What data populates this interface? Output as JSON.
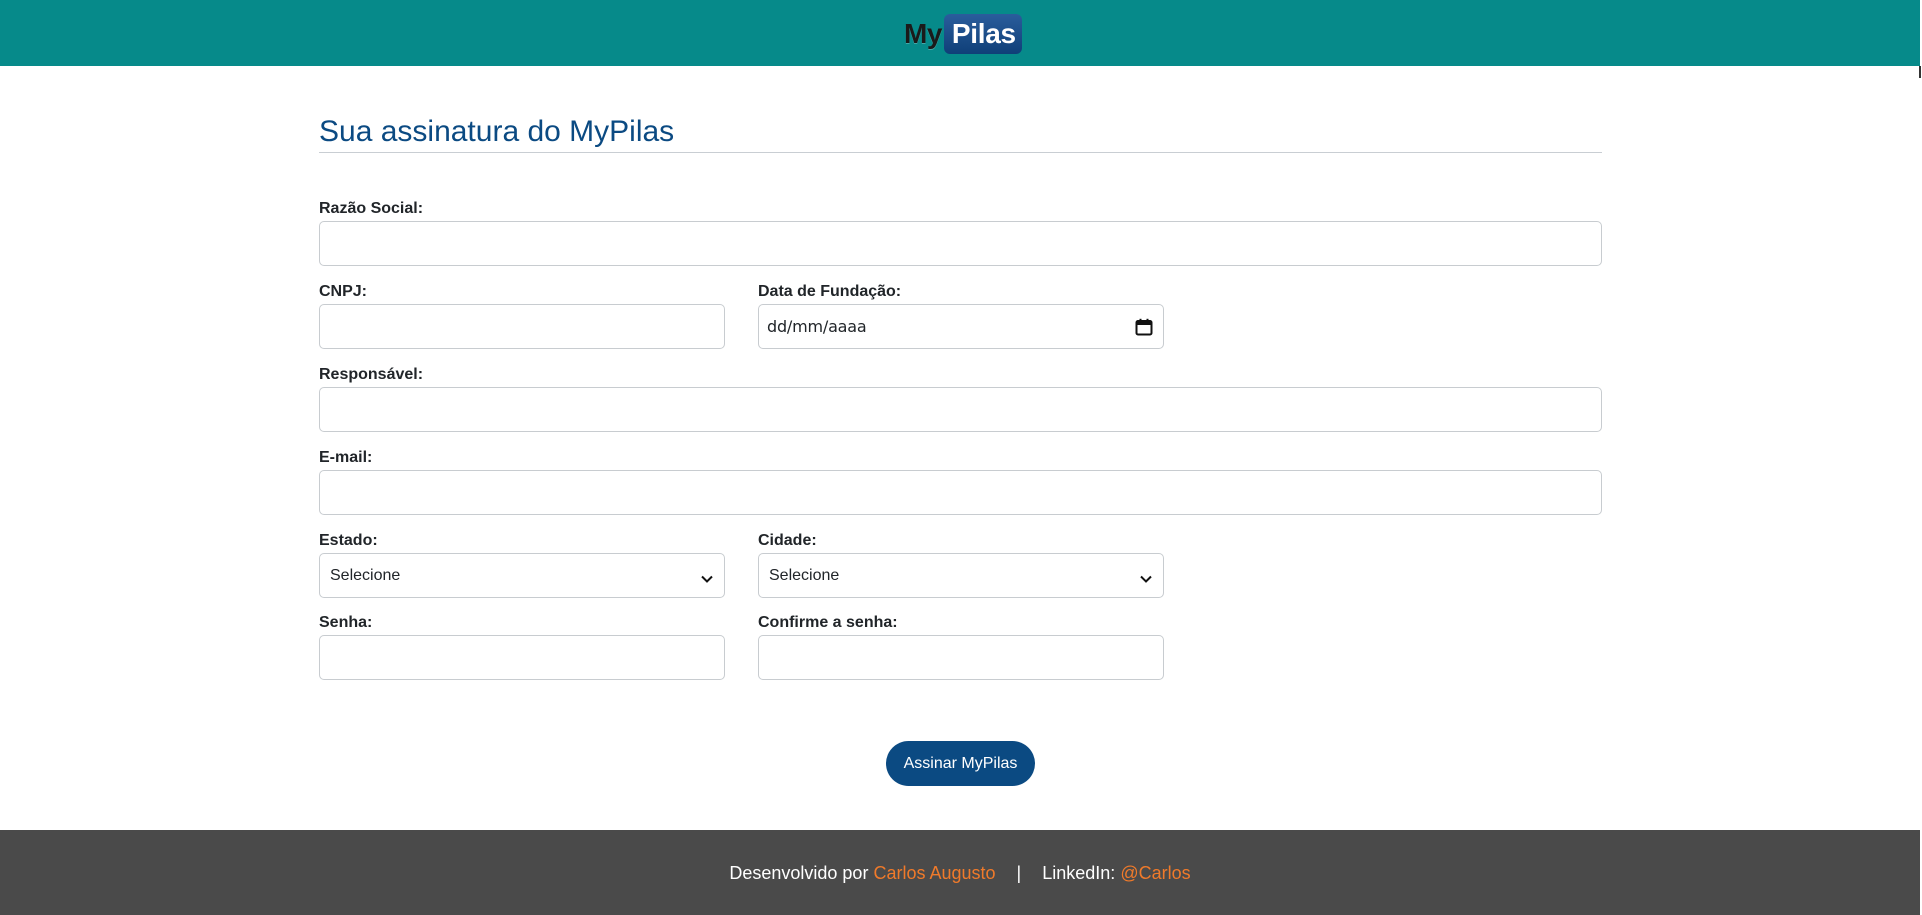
{
  "header": {
    "logo_part1": "My",
    "logo_part2": "Pilas",
    "background_color": "#068a8a"
  },
  "form": {
    "title": "Sua assinatura do MyPilas",
    "fields": {
      "razao_social": {
        "label": "Razão Social:",
        "value": ""
      },
      "cnpj": {
        "label": "CNPJ:",
        "value": ""
      },
      "data_fundacao": {
        "label": "Data de Fundação:",
        "placeholder": "dd/mm/aaaa"
      },
      "responsavel": {
        "label": "Responsável:",
        "value": ""
      },
      "email": {
        "label": "E-mail:",
        "value": ""
      },
      "estado": {
        "label": "Estado:",
        "selected": "Selecione"
      },
      "cidade": {
        "label": "Cidade:",
        "selected": "Selecione"
      },
      "senha": {
        "label": "Senha:",
        "value": ""
      },
      "confirme_senha": {
        "label": "Confirme a senha:",
        "value": ""
      }
    },
    "submit_label": "Assinar MyPilas",
    "accent_color": "#0b4a82"
  },
  "footer": {
    "developed_by_prefix": "Desenvolvido por",
    "developer_name": "Carlos Augusto",
    "separator": "|",
    "linkedin_prefix": "LinkedIn:",
    "linkedin_handle": "@Carlos",
    "link_color": "#f07a2a",
    "background_color": "#4a4a4a"
  }
}
